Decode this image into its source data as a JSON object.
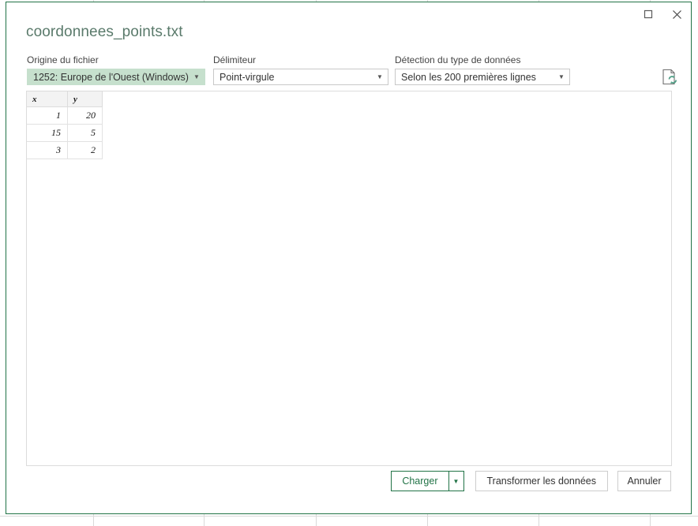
{
  "window": {
    "title": "coordonnees_points.txt",
    "maximize_label": "Agrandir",
    "close_label": "Fermer",
    "border_color": "#217346",
    "title_color": "#5a7a6b"
  },
  "options": {
    "origin": {
      "label": "Origine du fichier",
      "value": "1252: Europe de l'Ouest (Windows)",
      "highlight_color": "#c6e0cd"
    },
    "delimiter": {
      "label": "Délimiteur",
      "value": "Point-virgule"
    },
    "detection": {
      "label": "Détection du type de données",
      "value": "Selon les 200 premières lignes"
    }
  },
  "toolbar": {
    "refresh_icon": "document-refresh-icon"
  },
  "preview": {
    "columns": [
      "x",
      "y"
    ],
    "rows": [
      [
        "1",
        "20"
      ],
      [
        "15",
        "5"
      ],
      [
        "3",
        "2"
      ]
    ]
  },
  "footer": {
    "load_label": "Charger",
    "load_split_arrow": "▼",
    "transform_label": "Transformer les données",
    "cancel_label": "Annuler",
    "accent_color": "#217346"
  }
}
